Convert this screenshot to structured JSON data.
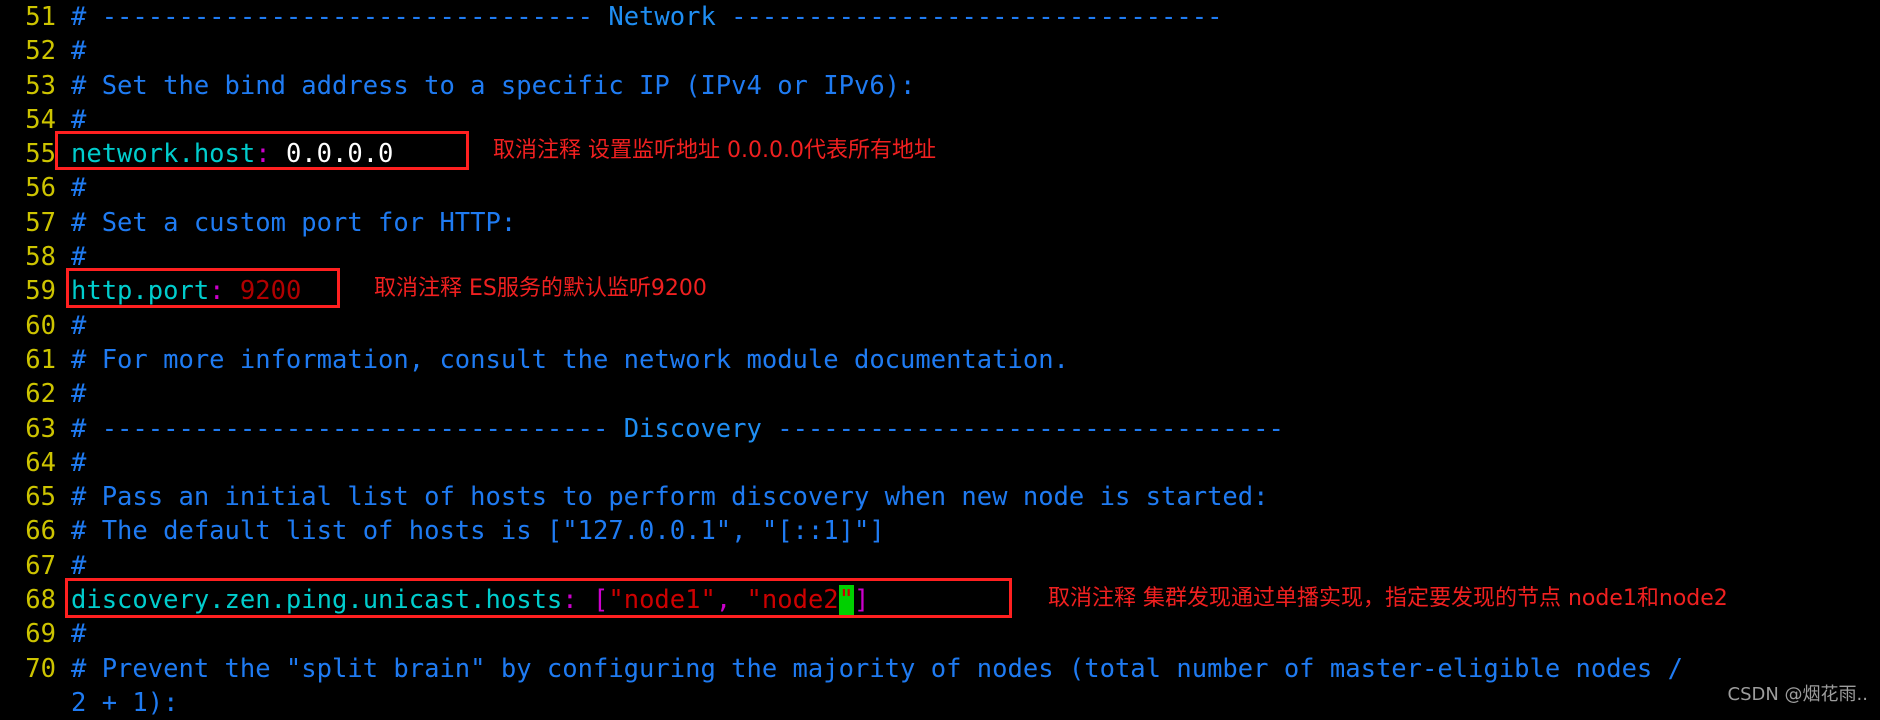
{
  "editor": {
    "app": "vim",
    "file": "elasticsearch.yml",
    "background_color": "#000000",
    "line_number_color": "#cdc400",
    "comment_color": "#1f7bf2",
    "key_color": "#00cdcd",
    "punct_color": "#cd00cd",
    "string_color": "#cd0000",
    "value_color": "#ffffff",
    "cursor_color": "#00d000",
    "annotation_color": "#f02020"
  },
  "lines": [
    {
      "num": "51",
      "text": "# -------------------------------- Network --------------------------------"
    },
    {
      "num": "52",
      "text": "#"
    },
    {
      "num": "53",
      "text": "# Set the bind address to a specific IP (IPv4 or IPv6):"
    },
    {
      "num": "54",
      "text": "#"
    },
    {
      "num": "55",
      "text": "network.host: 0.0.0.0"
    },
    {
      "num": "56",
      "text": "#"
    },
    {
      "num": "57",
      "text": "# Set a custom port for HTTP:"
    },
    {
      "num": "58",
      "text": "#"
    },
    {
      "num": "59",
      "text": "http.port: 9200"
    },
    {
      "num": "60",
      "text": "#"
    },
    {
      "num": "61",
      "text": "# For more information, consult the network module documentation."
    },
    {
      "num": "62",
      "text": "#"
    },
    {
      "num": "63",
      "text": "# --------------------------------- Discovery ---------------------------------"
    },
    {
      "num": "64",
      "text": "#"
    },
    {
      "num": "65",
      "text": "# Pass an initial list of hosts to perform discovery when new node is started:"
    },
    {
      "num": "66",
      "text": "# The default list of hosts is [\"127.0.0.1\", \"[::1]\"]"
    },
    {
      "num": "67",
      "text": "#"
    },
    {
      "num": "68",
      "text": "discovery.zen.ping.unicast.hosts: [\"node1\", \"node2\"]"
    },
    {
      "num": "69",
      "text": "#"
    },
    {
      "num": "70",
      "text": "# Prevent the \"split brain\" by configuring the majority of nodes (total number of master-eligible nodes /"
    },
    {
      "num": "",
      "text": "2 + 1):"
    }
  ],
  "tokens": {
    "l51_dash_left": "# -------------------------------- ",
    "l51_word": "Network",
    "l51_dash_right": " --------------------------------",
    "l52": "#",
    "l53": "# Set the bind address to a specific IP (IPv4 or IPv6):",
    "l54": "#",
    "l55_key": "network.host",
    "l55_colon": ":",
    "l55_value": " 0.0.0.0",
    "l56": "#",
    "l57": "# Set a custom port for HTTP:",
    "l58": "#",
    "l59_key": "http.port",
    "l59_colon": ":",
    "l59_value": " 9200",
    "l60": "#",
    "l61": "# For more information, consult the network module documentation.",
    "l62": "#",
    "l63_dash_left": "# --------------------------------- ",
    "l63_word": "Discovery",
    "l63_dash_right": " ---------------------------------",
    "l64": "#",
    "l65": "# Pass an initial list of hosts to perform discovery when new node is started:",
    "l66": "# The default list of hosts is [\"127.0.0.1\", \"[::1]\"]",
    "l67": "#",
    "l68_key": "discovery.zen.ping.unicast.hosts",
    "l68_colon": ":",
    "l68_open": " [",
    "l68_node1": "\"node1\"",
    "l68_comma": ",",
    "l68_node2": " \"node2",
    "l68_cursor": "\"",
    "l68_close": "]",
    "l69": "#",
    "l70": "# Prevent the \"split brain\" by configuring the majority of nodes (total number of master-eligible nodes /",
    "l70_wrap": "2 + 1):"
  },
  "line_numbers": {
    "n51": "51",
    "n52": "52",
    "n53": "53",
    "n54": "54",
    "n55": "55",
    "n56": "56",
    "n57": "57",
    "n58": "58",
    "n59": "59",
    "n60": "60",
    "n61": "61",
    "n62": "62",
    "n63": "63",
    "n64": "64",
    "n65": "65",
    "n66": "66",
    "n67": "67",
    "n68": "68",
    "n69": "69",
    "n70": "70",
    "n_wrap": " "
  },
  "annotations": {
    "network_host": "取消注释 设置监听地址 0.0.0.0代表所有地址",
    "http_port": "取消注释 ES服务的默认监听9200",
    "discovery_hosts": "取消注释 集群发现通过单播实现，指定要发现的节点 node1和node2"
  },
  "watermark": {
    "text": "CSDN @烟花雨.."
  }
}
